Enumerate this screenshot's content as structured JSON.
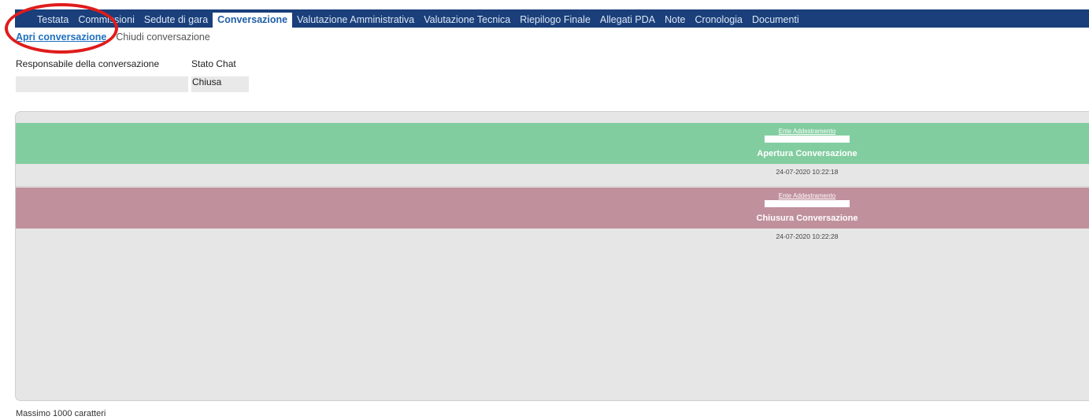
{
  "tabs": [
    {
      "label": "Testata"
    },
    {
      "label": "Commissioni"
    },
    {
      "label": "Sedute di gara"
    },
    {
      "label": "Conversazione",
      "active": true
    },
    {
      "label": "Valutazione Amministrativa"
    },
    {
      "label": "Valutazione Tecnica"
    },
    {
      "label": "Riepilogo Finale"
    },
    {
      "label": "Allegati PDA"
    },
    {
      "label": "Note"
    },
    {
      "label": "Cronologia"
    },
    {
      "label": "Documenti"
    }
  ],
  "subtabs": {
    "open": "Apri conversazione",
    "close": "Chiudi conversazione"
  },
  "fields": {
    "responsabile_label": "Responsabile della conversazione",
    "responsabile_value": "",
    "stato_label": "Stato Chat",
    "stato_value": "Chiusa"
  },
  "messages": [
    {
      "sender": "Ente Addestramento",
      "title": "Apertura Conversazione",
      "time": "24-07-2020 10:22:18"
    },
    {
      "sender": "Ente Addestramento",
      "title": "Chiusura Conversazione",
      "time": "24-07-2020 10:22:28"
    }
  ],
  "footer": {
    "note": "Massimo 1000 caratteri"
  },
  "colors": {
    "tabbar": "#1a3f7a",
    "open_message": "#82cda0",
    "close_message": "#c0909d",
    "annotation_circle": "#e01b1b"
  }
}
